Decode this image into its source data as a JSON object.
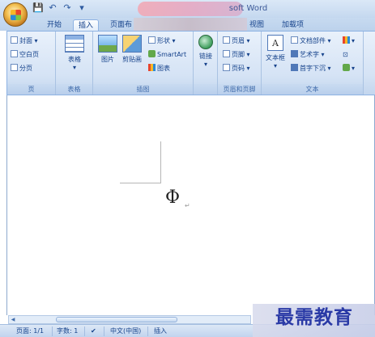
{
  "app": {
    "title_partial": "soft Word"
  },
  "qat": {
    "save": "💾",
    "undo": "↶",
    "redo": "↷",
    "more": "▾"
  },
  "tabs": [
    "开始",
    "插入",
    "页面布",
    "视图",
    "加载项"
  ],
  "ribbon": {
    "pages": {
      "cover": "封面 ▾",
      "blank": "空白页",
      "break": "分页",
      "group": "页"
    },
    "tables": {
      "table": "表格",
      "arrow": "▾",
      "group": "表格"
    },
    "illustrations": {
      "picture": "图片",
      "clipart": "剪贴画",
      "shapes": "形状 ▾",
      "smartart": "SmartArt",
      "chart": "图表",
      "group": "插图"
    },
    "links": {
      "link": "链接",
      "arrow": "▾"
    },
    "header_footer": {
      "header": "页眉 ▾",
      "footer": "页脚 ▾",
      "page_number": "页码 ▾",
      "group": "页眉和页脚"
    },
    "text": {
      "textbox": "文本框",
      "textbox_arrow": "▾",
      "quickparts": "文档部件 ▾",
      "wordart": "艺术字 ▾",
      "dropcap": "首字下沉 ▾",
      "group": "文本"
    },
    "letter_a": "A",
    "extra": {
      "sig": "▾",
      "date": "⊡",
      "obj": "▾"
    }
  },
  "document": {
    "symbol": "Φ",
    "para_mark": "↵"
  },
  "status": {
    "page": "页面: 1/1",
    "words": "字数: 1",
    "lang": "中文(中国)",
    "mode": "插入"
  },
  "watermark": "最需教育"
}
